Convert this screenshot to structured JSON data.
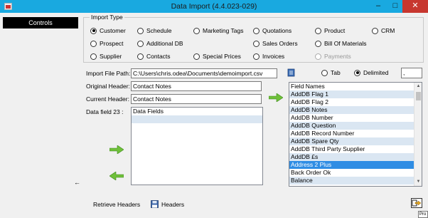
{
  "window": {
    "title": "Data Import (4.4.023-029)"
  },
  "sidebar": {
    "controls_label": "Controls",
    "small_arrow": "←"
  },
  "import_type": {
    "legend": "Import Type",
    "options": [
      {
        "label": "Customer",
        "selected": true
      },
      {
        "label": "Schedule"
      },
      {
        "label": "Marketing Tags"
      },
      {
        "label": "Quotations"
      },
      {
        "label": "Product"
      },
      {
        "label": "CRM"
      },
      {
        "label": "Prospect"
      },
      {
        "label": "Additional DB"
      },
      {
        "label": "Sales Orders"
      },
      {
        "label": "Bill Of Materials"
      },
      {
        "label": "Supplier"
      },
      {
        "label": "Contacts"
      },
      {
        "label": "Special Prices"
      },
      {
        "label": "Invoices"
      },
      {
        "label": "Payments",
        "disabled": true
      }
    ]
  },
  "file": {
    "label": "Import File Path:",
    "value": "C:\\Users\\chris.odea\\Documents\\demoimport.csv",
    "tab_label": "Tab",
    "delimited_label": "Delimited",
    "delimiter_value": ","
  },
  "headers": {
    "original_label": "Original Header:",
    "original_value": "Contact Notes",
    "current_label": "Current Header:",
    "current_value": "Contact Notes"
  },
  "data_fields": {
    "label": "Data field 23 :",
    "header": "Data Fields"
  },
  "field_names": {
    "items": [
      "Field Names",
      "AddDB Flag 1",
      "AddDB Flag 2",
      "AddDB Notes",
      "AddDB Number",
      "AddDB Question",
      "AddDB Record Number",
      "AddDB Spare Qty",
      "AddDB Third Party Supplier",
      "AddDB £s",
      "Address 2 Plus",
      "Back Order Ok",
      "Balance"
    ],
    "selected_index": 10
  },
  "bottom": {
    "retrieve_label": "Retrieve Headers",
    "headers_label": "Headers"
  },
  "tooltip_text": "Pro",
  "colors": {
    "titlebar": "#19a9e0",
    "selection": "#2f8de4",
    "close": "#c7372f"
  }
}
